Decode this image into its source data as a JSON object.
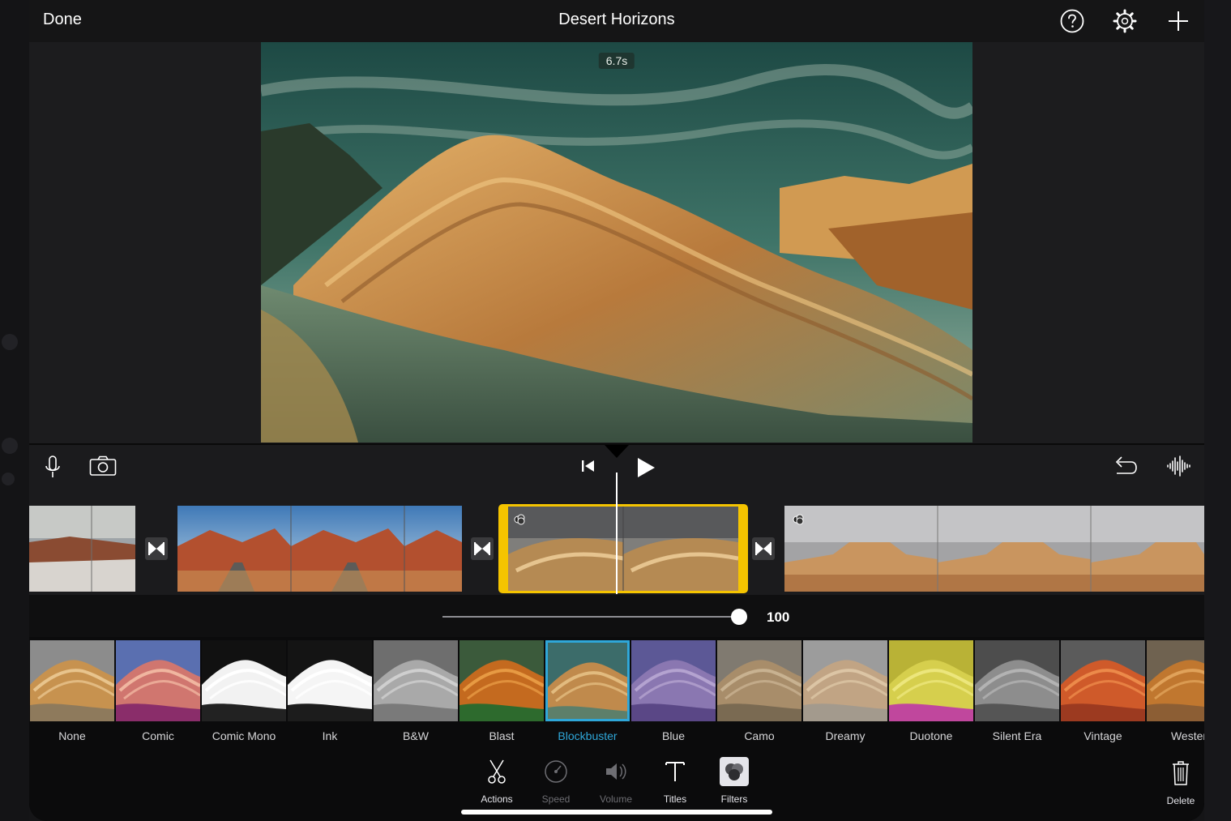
{
  "topbar": {
    "done_label": "Done",
    "project_title": "Desert Horizons",
    "icons": [
      "help-icon",
      "settings-gear-icon",
      "add-plus-icon"
    ]
  },
  "viewer": {
    "duration_label": "6.7s"
  },
  "controls": {
    "left_icons": [
      "microphone-icon",
      "camera-icon"
    ],
    "center_icons": [
      "skip-to-start-icon",
      "play-icon"
    ],
    "right_icons": [
      "undo-icon",
      "audio-waveform-icon"
    ]
  },
  "timeline": {
    "clips": [
      {
        "name": "clip-1",
        "selected": false,
        "has_filter": false
      },
      {
        "name": "clip-2",
        "selected": false,
        "has_filter": false
      },
      {
        "name": "clip-3",
        "selected": true,
        "has_filter": true
      },
      {
        "name": "clip-4",
        "selected": false,
        "has_filter": true
      }
    ],
    "transition_icon": "transition-bowtie-icon"
  },
  "intensity": {
    "value_label": "100",
    "value": 100
  },
  "filters": {
    "selected": "Blockbuster",
    "items": [
      {
        "label": "None"
      },
      {
        "label": "Comic"
      },
      {
        "label": "Comic Mono"
      },
      {
        "label": "Ink"
      },
      {
        "label": "B&W"
      },
      {
        "label": "Blast"
      },
      {
        "label": "Blockbuster"
      },
      {
        "label": "Blue"
      },
      {
        "label": "Camo"
      },
      {
        "label": "Dreamy"
      },
      {
        "label": "Duotone"
      },
      {
        "label": "Silent Era"
      },
      {
        "label": "Vintage"
      },
      {
        "label": "Wester"
      }
    ]
  },
  "toolbar": {
    "actions_label": "Actions",
    "speed_label": "Speed",
    "volume_label": "Volume",
    "titles_label": "Titles",
    "filters_label": "Filters",
    "delete_label": "Delete"
  },
  "colors": {
    "selection_yellow": "#f5c400",
    "selected_filter_blue": "#2fa7d9"
  }
}
